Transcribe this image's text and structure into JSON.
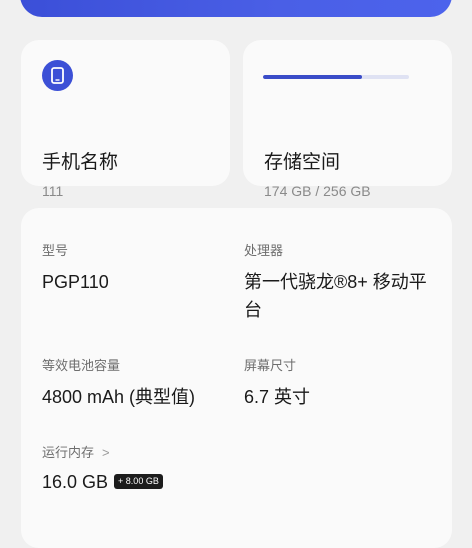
{
  "phone_card": {
    "icon": "phone-icon",
    "title": "手机名称",
    "value": "111"
  },
  "storage_card": {
    "title": "存储空间",
    "value": "174 GB / 256 GB",
    "used_fraction": 0.68
  },
  "specs": {
    "model": {
      "label": "型号",
      "value": "PGP110"
    },
    "processor": {
      "label": "处理器",
      "value": "第一代骁龙®8+ 移动平台"
    },
    "battery": {
      "label": "等效电池容量",
      "value": "4800 mAh (典型值)"
    },
    "screen": {
      "label": "屏幕尺寸",
      "value": "6.7 英寸"
    },
    "ram": {
      "label": "运行内存",
      "chevron": ">",
      "value": "16.0 GB",
      "badge": "+ 8.00 GB"
    }
  },
  "colors": {
    "accent": "#3c50d6",
    "banner": "#4a5fe6",
    "card_bg": "#fafafa",
    "page_bg": "#f0f0f0"
  }
}
